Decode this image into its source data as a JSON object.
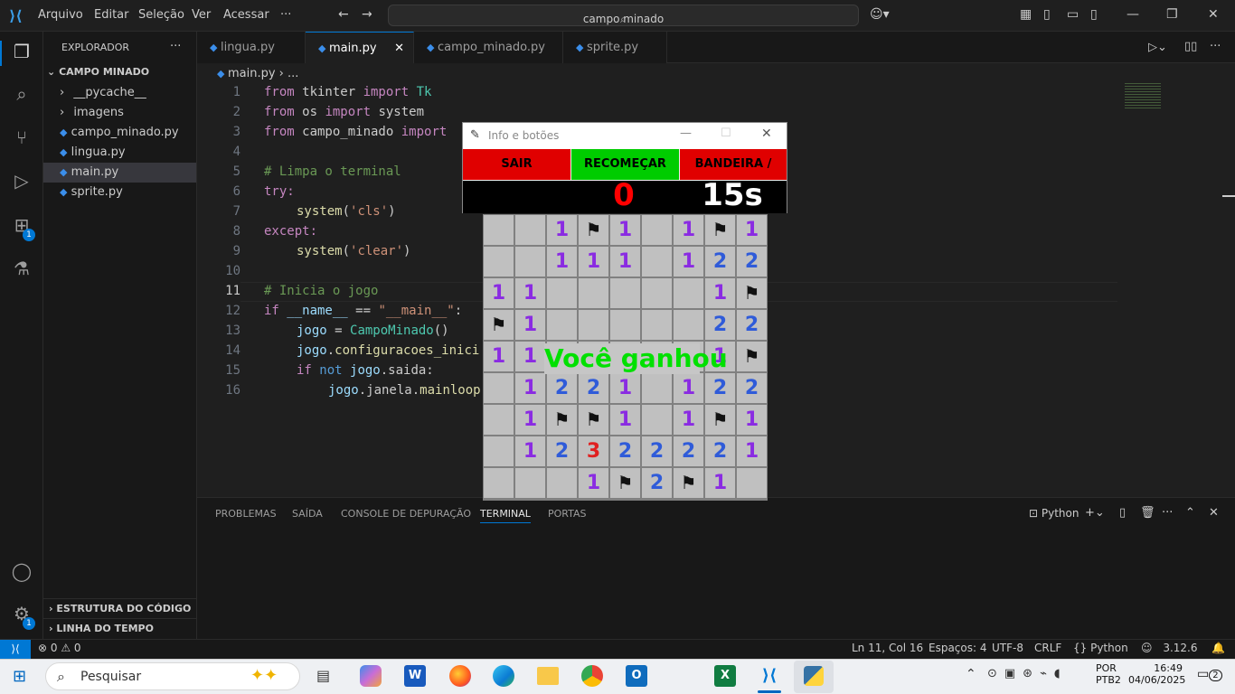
{
  "titlebar": {
    "menu": [
      "Arquivo",
      "Editar",
      "Seleção",
      "Ver",
      "Acessar"
    ],
    "more": "···",
    "search_text": "campo minado"
  },
  "sidebar": {
    "title": "EXPLORADOR",
    "more": "···",
    "project": "CAMPO MINADO",
    "items": [
      {
        "label": "__pycache__",
        "type": "folder"
      },
      {
        "label": "imagens",
        "type": "folder"
      },
      {
        "label": "campo_minado.py",
        "type": "file"
      },
      {
        "label": "lingua.py",
        "type": "file"
      },
      {
        "label": "main.py",
        "type": "file",
        "selected": true
      },
      {
        "label": "sprite.py",
        "type": "file"
      }
    ],
    "outline": "ESTRUTURA DO CÓDIGO",
    "timeline": "LINHA DO TEMPO"
  },
  "activity_badges": {
    "extensions": "1",
    "settings": "1"
  },
  "tabs": [
    {
      "label": "lingua.py"
    },
    {
      "label": "main.py",
      "active": true
    },
    {
      "label": "campo_minado.py"
    },
    {
      "label": "sprite.py"
    }
  ],
  "breadcrumb": {
    "file": "main.py",
    "rest": "..."
  },
  "code_lines": [
    "1",
    "2",
    "3",
    "4",
    "5",
    "6",
    "7",
    "8",
    "9",
    "10",
    "11",
    "12",
    "13",
    "14",
    "15",
    "16"
  ],
  "code": {
    "l1": [
      "from",
      " tkinter ",
      "import",
      " Tk"
    ],
    "l2": [
      "from",
      " os ",
      "import",
      " system"
    ],
    "l3": [
      "from",
      " campo_minado ",
      "import"
    ],
    "l5": "# Limpa o terminal",
    "l6": "try:",
    "l7": [
      "system",
      "(",
      "'cls'",
      ")"
    ],
    "l8": "except:",
    "l9": [
      "system",
      "(",
      "'clear'",
      ")"
    ],
    "l11": "# Inicia o jogo",
    "l12": [
      "if",
      " __name__ ",
      "==",
      " \"__main__\"",
      ":"
    ],
    "l13": [
      "jogo",
      " = ",
      "CampoMinado",
      "()"
    ],
    "l14": [
      "jogo",
      ".",
      "configuracoes_inici"
    ],
    "l15": [
      "if",
      " not ",
      "jogo",
      ".saida:"
    ],
    "l16": [
      "jogo",
      ".janela.",
      "mainloop"
    ]
  },
  "panel": {
    "tabs": [
      "PROBLEMAS",
      "SAÍDA",
      "CONSOLE DE DEPURAÇÃO",
      "TERMINAL",
      "PORTAS"
    ],
    "active": "TERMINAL",
    "terminal_label": "Python"
  },
  "statusbar": {
    "errors": "0",
    "warnings": "0",
    "position": "Ln 11, Col 16",
    "spaces": "Espaços: 4",
    "encoding": "UTF-8",
    "eol": "CRLF",
    "language": "Python",
    "version": "3.12.6"
  },
  "taskbar": {
    "search": "Pesquisar",
    "lang1": "POR",
    "lang2": "PTB2",
    "time": "16:49",
    "date": "04/06/2025",
    "notif": "2"
  },
  "tk": {
    "title": "Info e botões",
    "btn_exit": "SAIR",
    "btn_restart": "RECOMEÇAR",
    "btn_flag": "BANDEIRA / OFF",
    "mines_count": "0",
    "timer": "15s",
    "win_message": "Você ganhou",
    "colors": {
      "exit": "#e00000",
      "restart": "#00cc00",
      "flag": "#e00000",
      "one": "#8a2be2",
      "two": "#2f5bd9",
      "three": "#e02020",
      "win": "#00e000"
    },
    "board": [
      [
        "",
        "",
        "1",
        "F",
        "1",
        "",
        "1",
        "F",
        "1"
      ],
      [
        "",
        "",
        "1",
        "1",
        "1",
        "",
        "1",
        "2",
        "2"
      ],
      [
        "1",
        "1",
        "",
        "",
        "",
        "",
        "",
        "1",
        "F"
      ],
      [
        "F",
        "1",
        "",
        "",
        "",
        "",
        "",
        "2",
        "2"
      ],
      [
        "1",
        "1",
        "",
        "",
        "",
        "",
        "",
        "1",
        "F"
      ],
      [
        "",
        "1",
        "2",
        "2",
        "1",
        "",
        "1",
        "2",
        "2"
      ],
      [
        "",
        "1",
        "F",
        "F",
        "1",
        "",
        "1",
        "F",
        "1"
      ],
      [
        "",
        "1",
        "2",
        "3",
        "2",
        "2",
        "2",
        "2",
        "1"
      ],
      [
        "",
        "",
        "",
        "1",
        "F",
        "2",
        "F",
        "1",
        ""
      ]
    ]
  }
}
